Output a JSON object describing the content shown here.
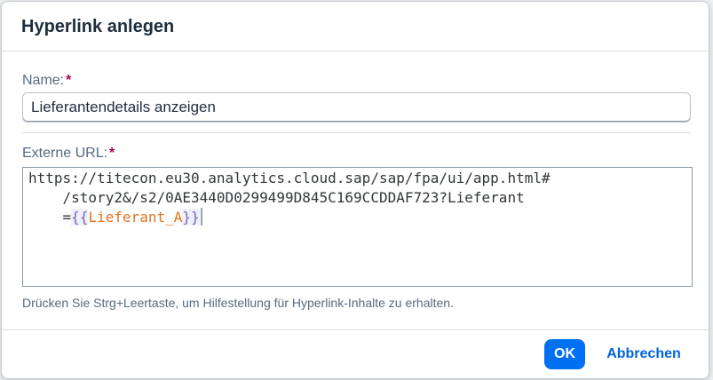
{
  "dialog": {
    "title": "Hyperlink anlegen"
  },
  "name_field": {
    "label": "Name:",
    "required_marker": "*",
    "value": "Lieferantendetails anzeigen"
  },
  "url_field": {
    "label": "Externe URL:",
    "required_marker": "*",
    "line1": "https://titecon.eu30.analytics.cloud.sap/sap/fpa/ui/app.html#",
    "line2": "    /story2&/s2/0AE3440D0299499D845C169CCDDAF723?Lieferant",
    "line3_prefix": "    =",
    "open_braces": "{{",
    "parameter": "Lieferant_A",
    "close_braces": "}}"
  },
  "hint": "Drücken Sie Strg+Leertaste, um Hilfestellung für Hyperlink-Inhalte zu erhalten.",
  "footer": {
    "ok_label": "OK",
    "cancel_label": "Abbrechen"
  },
  "colors": {
    "primary_button": "#0070f2",
    "link_button": "#0064d9",
    "required_marker": "#b00053",
    "bracket": "#7f5fc2",
    "parameter": "#e3731e"
  }
}
